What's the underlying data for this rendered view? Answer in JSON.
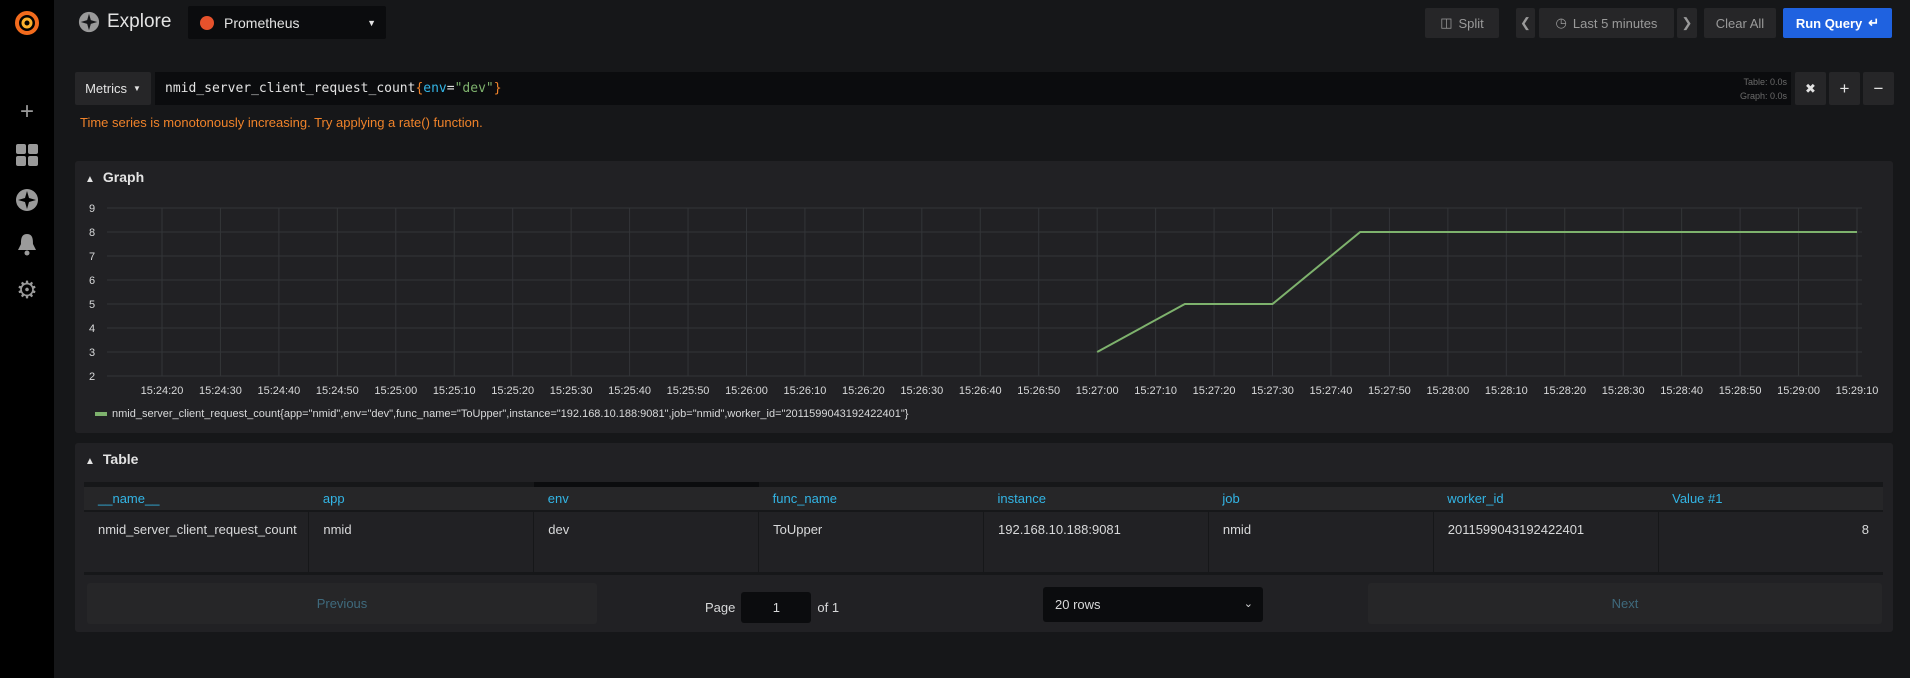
{
  "sidebar": {
    "items": [
      "grafana-logo",
      "plus-icon",
      "dashboards-icon",
      "explore-icon",
      "alert-bell-icon",
      "gear-icon"
    ]
  },
  "header": {
    "title": "Explore",
    "datasource": "Prometheus",
    "split": "Split",
    "time_range": "Last 5 minutes",
    "clear_all": "Clear All",
    "run_query": "Run Query"
  },
  "query": {
    "metrics_label": "Metrics",
    "expr_metric": "nmid_server_client_request_count",
    "expr_open": "{",
    "expr_key": "env",
    "expr_eq": "=",
    "expr_val": "\"dev\"",
    "expr_close": "}",
    "table_time": "Table: 0.0s",
    "graph_time": "Graph: 0.0s",
    "warning": "Time series is monotonously increasing. Try applying a rate() function."
  },
  "colors": {
    "accent": "#1f62e0",
    "warning": "#f0832a",
    "series": "#7eb26d",
    "header_text": "#33b5e5"
  },
  "graph": {
    "title": "Graph"
  },
  "chart_data": {
    "type": "line",
    "ylim": [
      2,
      9
    ],
    "yticks": [
      "9",
      "8",
      "7",
      "6",
      "5",
      "4",
      "3",
      "2"
    ],
    "xticks": [
      "15:24:20",
      "15:24:30",
      "15:24:40",
      "15:24:50",
      "15:25:00",
      "15:25:10",
      "15:25:20",
      "15:25:30",
      "15:25:40",
      "15:25:50",
      "15:26:00",
      "15:26:10",
      "15:26:20",
      "15:26:30",
      "15:26:40",
      "15:26:50",
      "15:27:00",
      "15:27:10",
      "15:27:20",
      "15:27:30",
      "15:27:40",
      "15:27:50",
      "15:28:00",
      "15:28:10",
      "15:28:20",
      "15:28:30",
      "15:28:40",
      "15:28:50",
      "15:29:00",
      "15:29:10"
    ],
    "grid": true,
    "legend_position": "bottom",
    "series": [
      {
        "name": "nmid_server_client_request_count{app=\"nmid\",env=\"dev\",func_name=\"ToUpper\",instance=\"192.168.10.188:9081\",job=\"nmid\",worker_id=\"2011599043192422401\"}",
        "x": [
          "15:27:00",
          "15:27:15",
          "15:27:30",
          "15:27:45",
          "15:28:00",
          "15:28:15",
          "15:28:30",
          "15:28:45",
          "15:29:00",
          "15:29:10"
        ],
        "y": [
          3,
          5,
          5,
          8,
          8,
          8,
          8,
          8,
          8,
          8
        ]
      }
    ]
  },
  "table": {
    "title": "Table",
    "columns": [
      "__name__",
      "app",
      "env",
      "func_name",
      "instance",
      "job",
      "worker_id",
      "Value #1"
    ],
    "rows": [
      [
        "nmid_server_client_request_count",
        "nmid",
        "dev",
        "ToUpper",
        "192.168.10.188:9081",
        "nmid",
        "2011599043192422401",
        "8"
      ]
    ],
    "previous": "Previous",
    "page_label": "Page",
    "page": "1",
    "of": "of 1",
    "rows_select": "20 rows",
    "next": "Next"
  }
}
